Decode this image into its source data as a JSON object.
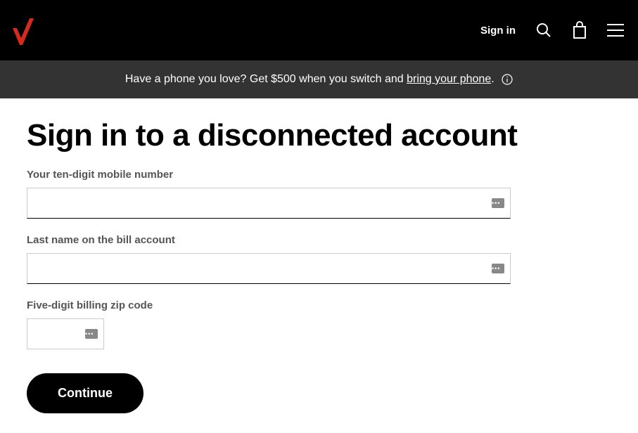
{
  "header": {
    "sign_in_label": "Sign in"
  },
  "promo": {
    "text_before": "Have a phone you love? Get $500 when you switch and ",
    "link_text": "bring your phone",
    "text_after": "."
  },
  "page": {
    "title": "Sign in to a disconnected account"
  },
  "form": {
    "mobile_label": "Your ten-digit mobile number",
    "mobile_value": "",
    "lastname_label": "Last name on the bill account",
    "lastname_value": "",
    "zip_label": "Five-digit billing zip code",
    "zip_value": "",
    "continue_label": "Continue"
  }
}
